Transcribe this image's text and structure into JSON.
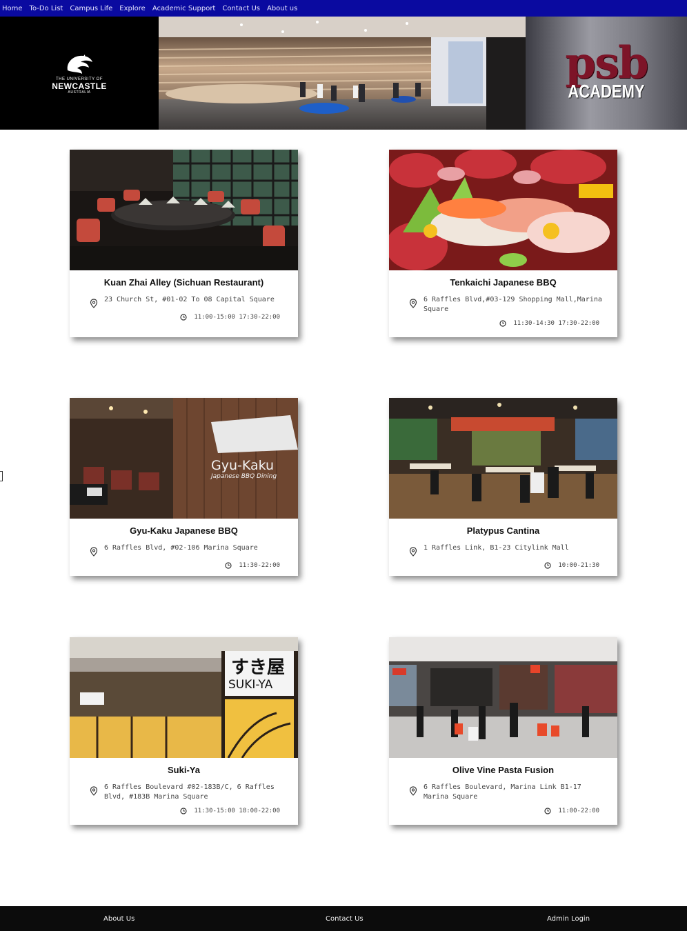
{
  "nav": {
    "items": [
      {
        "label": "Home"
      },
      {
        "label": "To-Do List"
      },
      {
        "label": "Campus Life"
      },
      {
        "label": "Explore"
      },
      {
        "label": "Academic Support"
      },
      {
        "label": "Contact Us"
      },
      {
        "label": "About us"
      }
    ]
  },
  "banner": {
    "uni_line1": "THE UNIVERSITY OF",
    "uni_line2": "NEWCASTLE",
    "uni_line3": "AUSTRALIA",
    "psb_main": "psb",
    "psb_sub": "ACADEMY"
  },
  "restaurants": [
    {
      "name": "Kuan Zhai Alley (Sichuan Restaurant)",
      "address": "23 Church St, #01-02 To 08 Capital Square",
      "hours": "11:00-15:00 17:30-22:00"
    },
    {
      "name": "Tenkaichi Japanese BBQ",
      "address": "6 Raffles Blvd,#03-129 Shopping Mall,Marina Square",
      "hours": "11:30-14:30 17:30-22:00"
    },
    {
      "name": "Gyu-Kaku Japanese BBQ",
      "address": "6 Raffles Blvd, #02-106 Marina Square",
      "hours": "11:30-22:00",
      "sign_text_1": "Gyu-Kaku",
      "sign_text_2": "Japanese BBQ Dining"
    },
    {
      "name": "Platypus Cantina",
      "address": "1 Raffles Link, B1-23 Citylink Mall",
      "hours": "10:00-21:30"
    },
    {
      "name": "Suki-Ya",
      "address": "6 Raffles Boulevard #02-183B/C, 6 Raffles Blvd, #183B Marina Square",
      "hours": "11:30-15:00 18:00-22:00",
      "sign_text_1": "すき屋",
      "sign_text_2": "SUKI-YA"
    },
    {
      "name": "Olive Vine Pasta Fusion",
      "address": "6 Raffles Boulevard, Marina Link B1-17 Marina Square",
      "hours": "11:00-22:00"
    }
  ],
  "footer": {
    "about": "About Us",
    "contact": "Contact Us",
    "admin": "Admin Login"
  },
  "colors": {
    "nav_bg": "#0a0aa0",
    "footer_bg": "#0c0c0c",
    "psb_brand": "#7d1428"
  }
}
